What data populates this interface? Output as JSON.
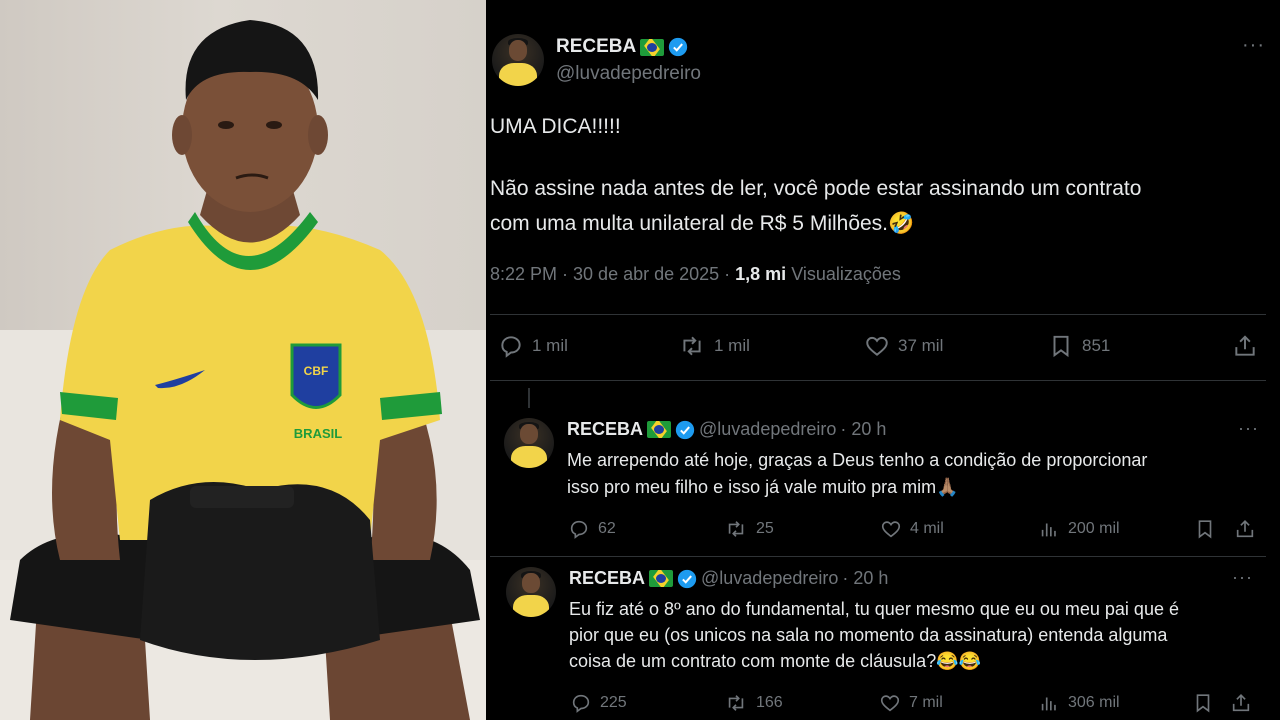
{
  "main_post": {
    "display_name": "RECEBA",
    "handle": "@luvadepedreiro",
    "text_line1": "UMA DICA!!!!!",
    "text_line2": "Não assine nada antes de ler, você pode estar assinando um contrato",
    "text_line3": "com uma multa unilateral de R$ 5 Milhões.🤣",
    "timestamp": "8:22 PM · 30 de abr de 2025 · ",
    "views_count": "1,8 mi",
    "views_label": " Visualizações",
    "replies": "1 mil",
    "reposts": "1 mil",
    "likes": "37 mil",
    "bookmarks": "851"
  },
  "replies": [
    {
      "display_name": "RECEBA",
      "handle": "@luvadepedreiro",
      "time": "· 20 h",
      "line1": "Me arrependo até hoje, graças a Deus tenho a condição de proporcionar",
      "line2": "isso pro meu filho e isso já vale muito pra mim🙏🏽",
      "replies": "62",
      "reposts": "25",
      "likes": "4 mil",
      "views": "200 mil"
    },
    {
      "display_name": "RECEBA",
      "handle": "@luvadepedreiro",
      "time": "· 20 h",
      "line1": "Eu fiz até o 8º ano do fundamental, tu quer mesmo que eu ou meu pai que é",
      "line2": "pior que eu (os unicos na sala no momento da assinatura) entenda alguma",
      "line3": "coisa de um contrato com monte de cláusula?😂😂",
      "replies": "225",
      "reposts": "166",
      "likes": "7 mil",
      "views": "306 mil"
    }
  ],
  "photo": {
    "shirt_brand": "CBF",
    "shirt_text": "BRASIL"
  },
  "icons": {
    "more": "more-icon",
    "reply": "reply-icon",
    "repost": "repost-icon",
    "like": "like-icon",
    "bookmark": "bookmark-icon",
    "share": "share-icon",
    "views": "views-icon",
    "verified": "verified-badge-icon"
  },
  "colors": {
    "background": "#000000",
    "text": "#e7e9ea",
    "muted": "#71767b",
    "verified": "#1d9bf0",
    "shirt_yellow": "#f2d44a",
    "shirt_green": "#1f9b3a"
  }
}
